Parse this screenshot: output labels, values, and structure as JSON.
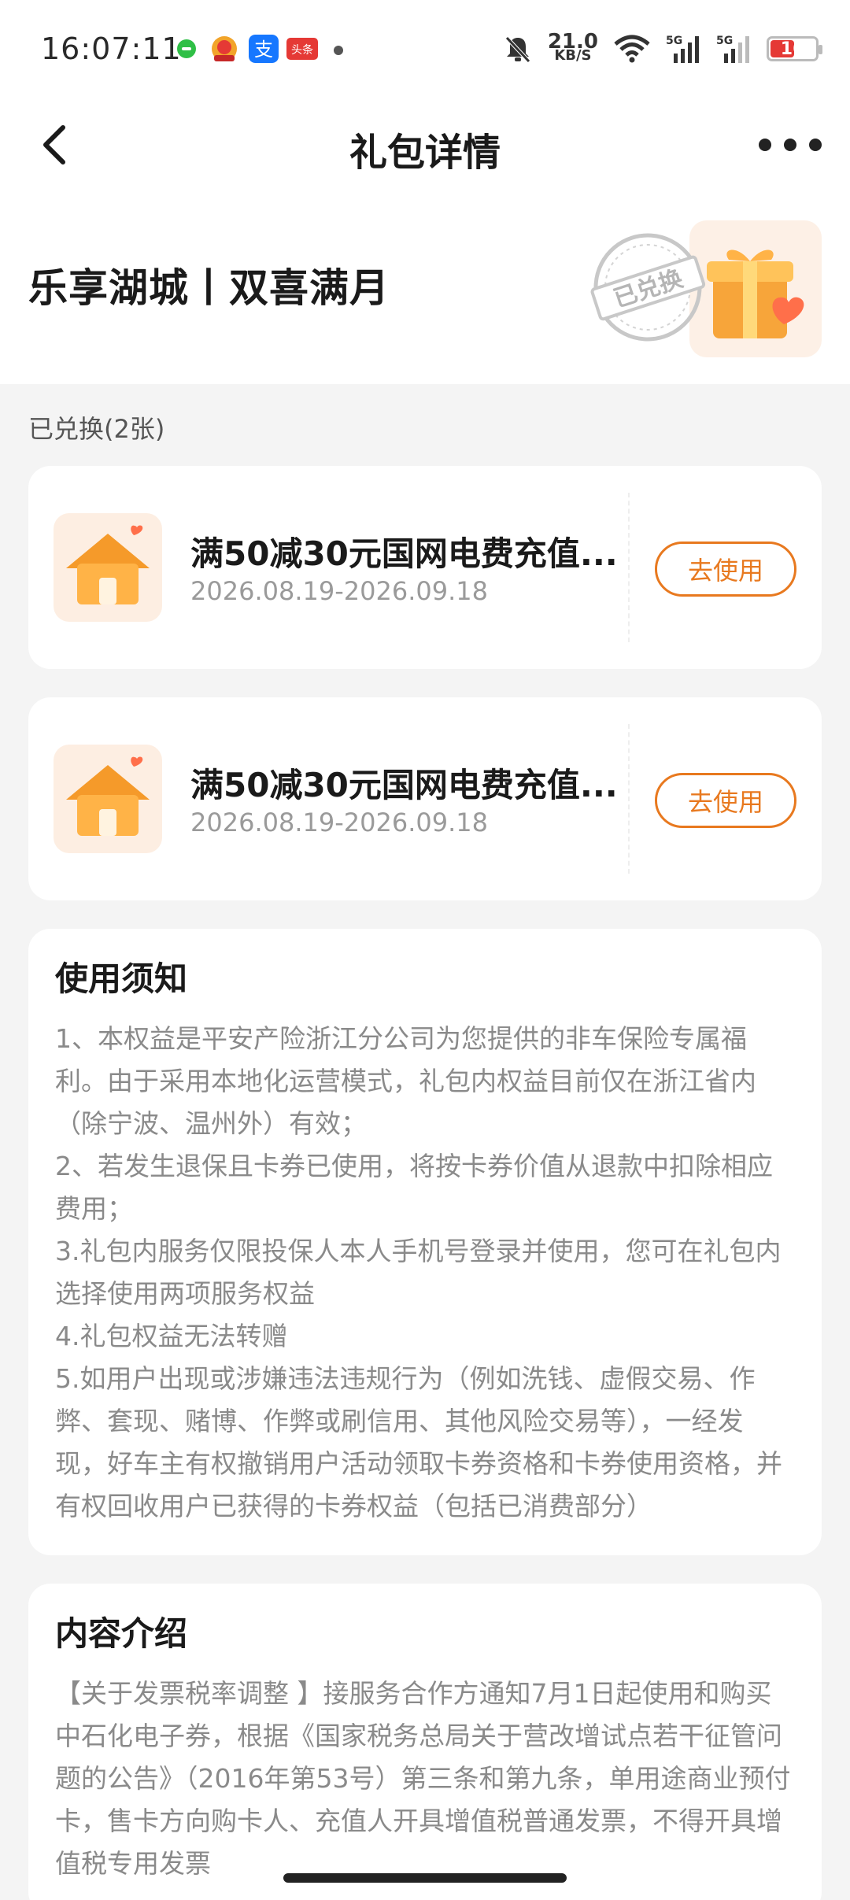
{
  "status_bar": {
    "time": "16:07:11",
    "net_speed_value": "21.0",
    "net_speed_unit": "KB/S",
    "battery_level": "16",
    "notif_toutiao_label": "头条"
  },
  "nav": {
    "title": "礼包详情"
  },
  "header": {
    "package_title": "乐享湖城丨双喜满月",
    "stamp_text": "已兑换"
  },
  "redeemed": {
    "label": "已兑换(2张)"
  },
  "coupons": [
    {
      "title": "满50减30元国网电费充值...",
      "date_range": "2026.08.19-2026.09.18",
      "button_label": "去使用"
    },
    {
      "title": "满50减30元国网电费充值...",
      "date_range": "2026.08.19-2026.09.18",
      "button_label": "去使用"
    }
  ],
  "usage_notice": {
    "heading": "使用须知",
    "body": "1、本权益是平安产险浙江分公司为您提供的非车保险专属福利。由于采用本地化运营模式，礼包内权益目前仅在浙江省内（除宁波、温州外）有效；\n2、若发生退保且卡券已使用，将按卡券价值从退款中扣除相应费用；\n3.礼包内服务仅限投保人本人手机号登录并使用，您可在礼包内选择使用两项服务权益\n4.礼包权益无法转赠\n5.如用户出现或涉嫌违法违规行为（例如洗钱、虚假交易、作弊、套现、赌博、作弊或刷信用、其他风险交易等），一经发现，好车主有权撤销用户活动领取卡券资格和卡券使用资格，并有权回收用户已获得的卡券权益（包括已消费部分）"
  },
  "content_intro": {
    "heading": "内容介绍",
    "body": "【关于发票税率调整 】接服务合作方通知7月1日起使用和购买中石化电子券，根据《国家税务总局关于营改增试点若干征管问题的公告》（2016年第53号）第三条和第九条，单用途商业预付卡，售卡方向购卡人、充值人开具增值税普通发票，不得开具增值税专用发票"
  },
  "colors": {
    "accent": "#e8791f",
    "background": "#f4f4f4",
    "card": "#ffffff",
    "muted_text": "#8a8a8a"
  }
}
